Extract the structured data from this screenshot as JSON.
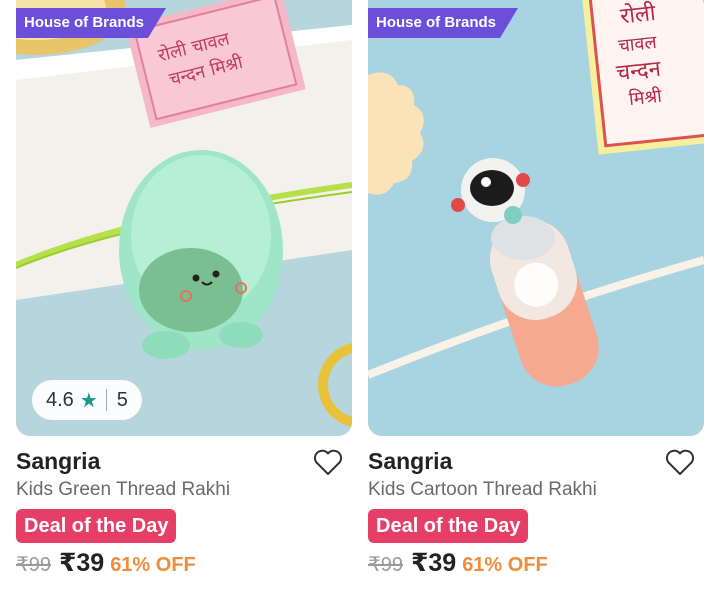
{
  "products": [
    {
      "badge": "House of Brands",
      "rating": {
        "value": "4.6",
        "count": "5"
      },
      "brand": "Sangria",
      "name": "Kids Green Thread Rakhi",
      "deal_label": "Deal of the Day",
      "mrp": "₹99",
      "price": "₹39",
      "discount": "61% OFF",
      "card_text": "रोली चावल चन्दन मिश्री"
    },
    {
      "badge": "House of Brands",
      "brand": "Sangria",
      "name": "Kids Cartoon Thread Rakhi",
      "deal_label": "Deal of the Day",
      "mrp": "₹99",
      "price": "₹39",
      "discount": "61% OFF",
      "card_text": "रोली चावल चन्दन मिश्री"
    }
  ],
  "colors": {
    "badge": "#6b4fd8",
    "deal": "#e63e66",
    "discount": "#f08d3c",
    "rating_star": "#159a8a"
  },
  "icons": [
    "star-icon",
    "heart-outline-icon"
  ]
}
